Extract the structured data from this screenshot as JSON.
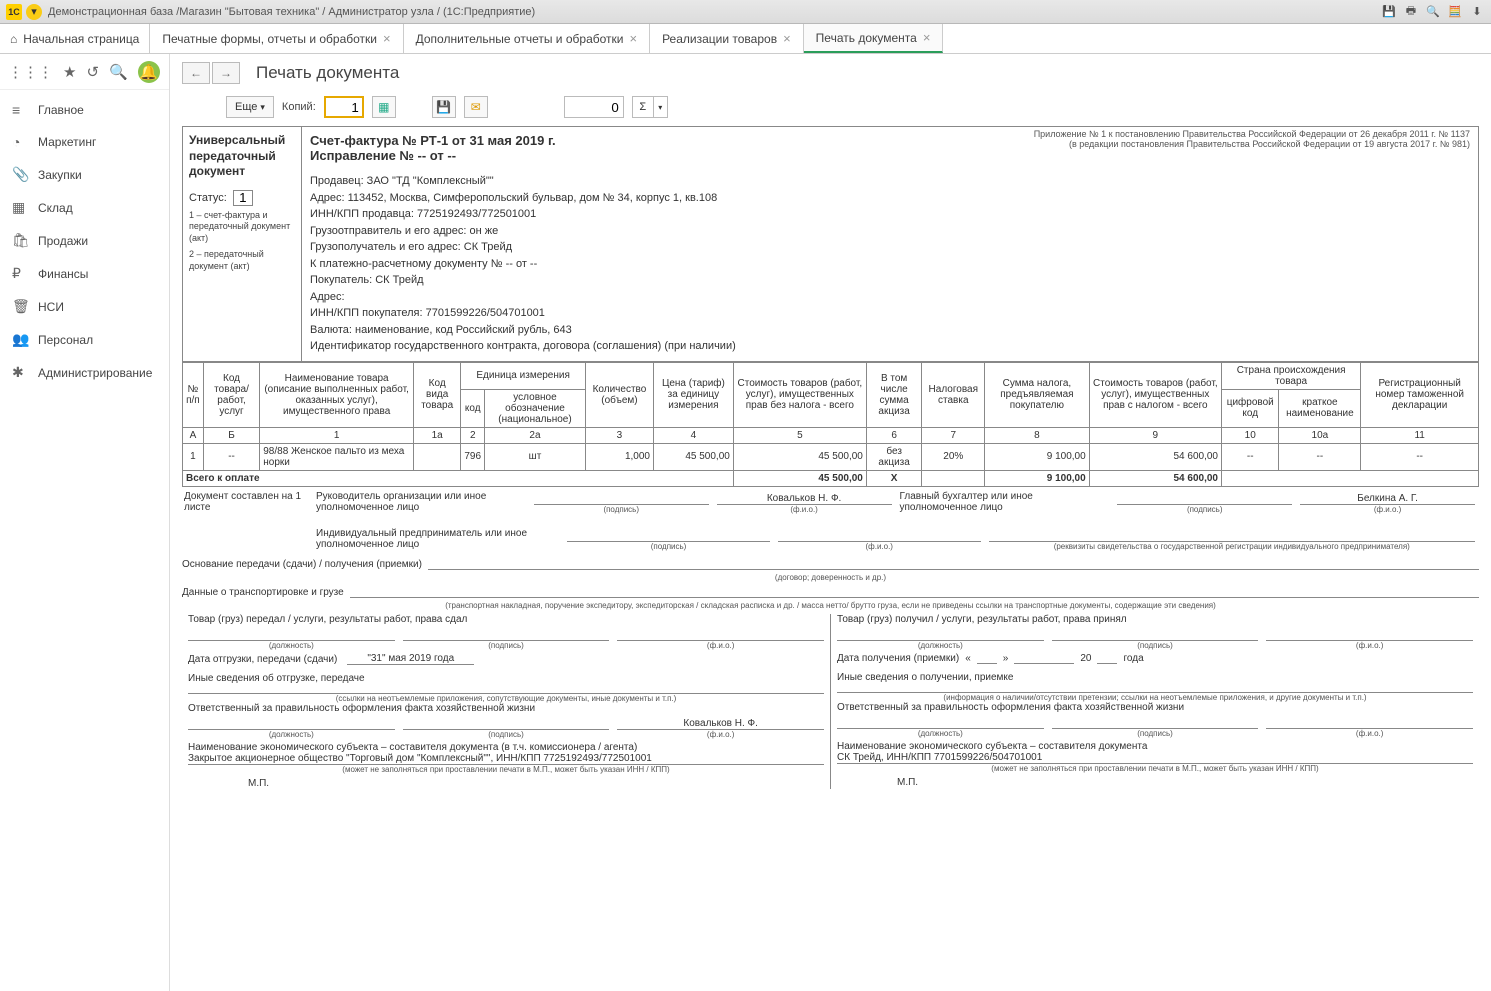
{
  "titlebar": {
    "text": "Демонстрационная база /Магазин \"Бытовая техника\" / Администратор узла / (1С:Предприятие)"
  },
  "tabs": {
    "home": "Начальная страница",
    "t1": "Печатные формы, отчеты и обработки",
    "t2": "Дополнительные отчеты и обработки",
    "t3": "Реализации товаров",
    "t4": "Печать документа"
  },
  "sidebar": {
    "items": [
      {
        "icon": "≡",
        "label": "Главное"
      },
      {
        "icon": "◔",
        "label": "Маркетинг"
      },
      {
        "icon": "📎",
        "label": "Закупки"
      },
      {
        "icon": "▦",
        "label": "Склад"
      },
      {
        "icon": "🛍",
        "label": "Продажи"
      },
      {
        "icon": "₽",
        "label": "Финансы"
      },
      {
        "icon": "🗑",
        "label": "НСИ"
      },
      {
        "icon": "👥",
        "label": "Персонал"
      },
      {
        "icon": "✱",
        "label": "Администрирование"
      }
    ]
  },
  "page": {
    "title": "Печать документа"
  },
  "toolbar": {
    "more": "Еще",
    "copies_label": "Копий:",
    "copies": "1",
    "num": "0"
  },
  "upd": {
    "title_l1": "Универсальный",
    "title_l2": "передаточный",
    "title_l3": "документ",
    "status_label": "Статус:",
    "status_val": "1",
    "note1": "1 – счет-фактура и передаточный документ (акт)",
    "note2": "2 – передаточный документ (акт)"
  },
  "invoice": {
    "title": "Счет-фактура № РТ-1 от 31 мая 2019 г.",
    "corr": "Исправление № -- от --",
    "app1": "Приложение № 1 к постановлению Правительства Российской Федерации от 26 декабря 2011 г. № 1137",
    "app2": "(в редакции постановления Правительства Российской Федерации от 19 августа 2017 г. № 981)",
    "seller": "Продавец: ЗАО \"ТД \"Комплексный\"\"",
    "addr": "Адрес: 113452, Москва, Симферопольский бульвар, дом № 34, корпус 1, кв.108",
    "inn": "ИНН/КПП продавца: 7725192493/772501001",
    "shipper": "Грузоотправитель и его адрес: он же",
    "consignee": "Грузополучатель и его адрес: СК Трейд",
    "paydoc": "К платежно-расчетному документу № -- от --",
    "buyer": "Покупатель: СК Трейд",
    "baddr": "Адрес:",
    "binn": "ИНН/КПП покупателя: 7701599226/504701001",
    "currency": "Валюта: наименование, код Российский рубль, 643",
    "contract": "Идентификатор государственного контракта, договора (соглашения) (при наличии)"
  },
  "table": {
    "h": {
      "num": "№ п/п",
      "code": "Код товара/ работ, услуг",
      "name": "Наименование товара (описание выполненных работ, оказанных услуг), имущественного права",
      "kind": "Код вида товара",
      "unit": "Единица измерения",
      "unit_code": "код",
      "unit_name": "условное обозначение (национальное)",
      "qty": "Количество (объем)",
      "price": "Цена (тариф) за единицу измерения",
      "cost_notax": "Стоимость товаров (работ, услуг), имущественных прав без налога - всего",
      "excise": "В том числе сумма акциза",
      "rate": "Налоговая ставка",
      "tax_sum": "Сумма налога, предъявляемая покупателю",
      "cost_tax": "Стоимость товаров (работ, услуг), имущественных прав с налогом - всего",
      "country": "Страна происхождения товара",
      "c_code": "цифровой код",
      "c_name": "краткое наименование",
      "decl": "Регистрационный номер таможенной декларации"
    },
    "colnums": [
      "А",
      "Б",
      "1",
      "1а",
      "2",
      "2а",
      "3",
      "4",
      "5",
      "6",
      "7",
      "8",
      "9",
      "10",
      "10а",
      "11"
    ],
    "row": {
      "n": "1",
      "code": "--",
      "name": "98/88 Женское пальто из меха норки",
      "kind": "",
      "ucode": "796",
      "uname": "шт",
      "qty": "1,000",
      "price": "45 500,00",
      "cost": "45 500,00",
      "excise": "без акциза",
      "rate": "20%",
      "tax": "9 100,00",
      "total": "54 600,00",
      "cc": "--",
      "cn": "--",
      "decl": "--"
    },
    "total_label": "Всего к оплате",
    "total": {
      "cost": "45 500,00",
      "excise": "X",
      "tax": "9 100,00",
      "total": "54 600,00"
    }
  },
  "sigs": {
    "doc_pages": "Документ составлен на 1 листе",
    "head": "Руководитель организации или иное уполномоченное лицо",
    "head_name": "Ковальков Н. Ф.",
    "acc": "Главный бухгалтер или иное уполномоченное лицо",
    "acc_name": "Белкина А. Г.",
    "ip": "Индивидуальный предприниматель или иное уполномоченное лицо",
    "sign": "(подпись)",
    "fio": "(ф.и.о.)",
    "rekv": "(реквизиты свидетельства о государственной  регистрации индивидуального предпринимателя)"
  },
  "bottom": {
    "l1": "Основание передачи (сдачи) / получения (приемки)",
    "l1c": "(договор; доверенность и др.)",
    "l2": "Данные о транспортировке и грузе",
    "l2c": "(транспортная накладная, поручение экспедитору, экспедиторская / складская расписка и др. / масса нетто/ брутто груза, если не приведены ссылки на транспортные документы, содержащие эти сведения)"
  },
  "left": {
    "t1": "Товар (груз) передал / услуги, результаты работ, права сдал",
    "pos": "(должность)",
    "sign": "(подпись)",
    "fio": "(ф.и.о.)",
    "date_l": "Дата отгрузки, передачи (сдачи)",
    "date_v": "\"31\" мая 2019 года",
    "other": "Иные сведения об отгрузке, передаче",
    "other_c": "(ссылки на неотъемлемые приложения, сопутствующие документы, иные документы и т.п.)",
    "resp": "Ответственный за правильность оформления факта хозяйственной жизни",
    "resp_name": "Ковальков Н. Ф.",
    "subj": "Наименование экономического субъекта – составителя документа (в т.ч. комиссионера / агента)",
    "subj_v": "Закрытое акционерное общество \"Торговый дом \"Комплексный\"\", ИНН/КПП 7725192493/772501001",
    "subj_c": "(может не заполняться при проставлении печати в М.П., может быть указан ИНН / КПП)",
    "mp": "М.П."
  },
  "right": {
    "t1": "Товар (груз) получил / услуги, результаты работ, права принял",
    "date_l": "Дата получения (приемки)",
    "date_v1": "«",
    "date_v2": "»",
    "date_v3": "20",
    "date_v4": "года",
    "other": "Иные сведения о получении, приемке",
    "other_c": "(информация о наличии/отсутствии претензии; ссылки на неотъемлемые приложения, и другие документы и т.п.)",
    "resp": "Ответственный за правильность оформления факта хозяйственной жизни",
    "subj": "Наименование экономического субъекта – составителя документа",
    "subj_v": "СК Трейд, ИНН/КПП 7701599226/504701001",
    "subj_c": "(может не заполняться при проставлении печати в М.П., может быть указан ИНН / КПП)",
    "mp": "М.П."
  }
}
